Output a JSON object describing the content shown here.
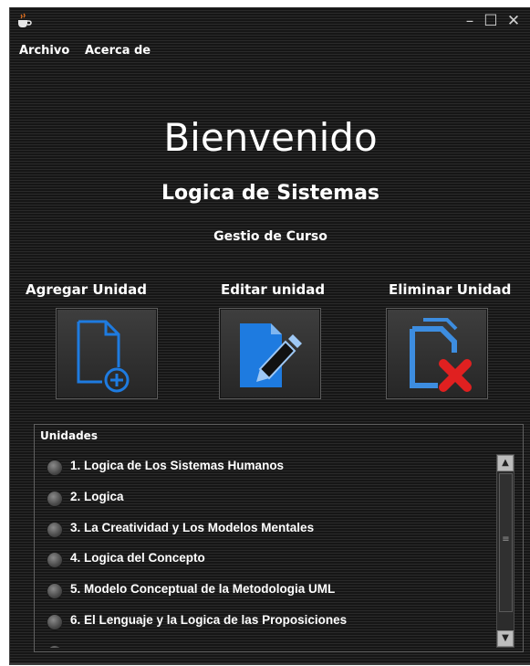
{
  "window": {
    "controls": {
      "minimize": "–",
      "maximize": "☐",
      "close": "✕"
    },
    "icon": "java-cup-icon"
  },
  "menu": {
    "file": "Archivo",
    "about": "Acerca de"
  },
  "header": {
    "welcome": "Bienvenido",
    "subtitle": "Logica de Sistemas",
    "course": "Gestio de Curso"
  },
  "actions": {
    "add": {
      "label": "Agregar Unidad",
      "icon": "add-document-icon",
      "color": "#1e7be0"
    },
    "edit": {
      "label": "Editar unidad",
      "icon": "edit-document-icon",
      "color": "#1e7be0"
    },
    "delete": {
      "label": "Eliminar Unidad",
      "icon": "delete-document-icon",
      "color": "#e02020"
    }
  },
  "units": {
    "title": "Unidades",
    "items": [
      "1. Logica de Los Sistemas Humanos",
      "2. Logica",
      "3. La Creatividad y Los Modelos Mentales",
      "4. Logica del Concepto",
      "5. Modelo Conceptual de la Metodologia UML",
      "6. El Lenguaje y la Logica de las Proposiciones"
    ]
  }
}
